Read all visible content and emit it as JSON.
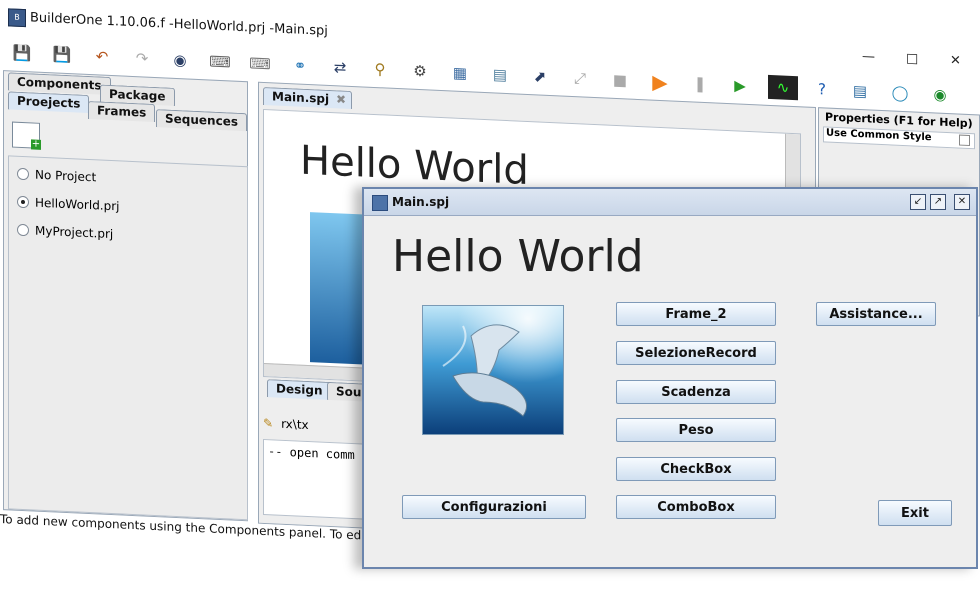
{
  "window": {
    "title": "BuilderOne 1.10.06.f -HelloWorld.prj -Main.spj",
    "app_icon": "app-icon"
  },
  "toolbar": {
    "icons": [
      "save-icon",
      "save-all-icon",
      "undo-icon",
      "redo-icon",
      "binoculars-icon",
      "keyboard-icon",
      "keyboard-small-icon",
      "network-icon",
      "connector-icon",
      "key-icon",
      "gear-icon",
      "table-icon",
      "book-icon",
      "export-icon",
      "expand-icon",
      "stop-icon",
      "play-icon",
      "pause-icon",
      "run-icon",
      "monitor-icon",
      "help-icon",
      "image-icon",
      "globe-icon",
      "eye-icon"
    ]
  },
  "left_panel": {
    "tabs_row1": [
      "Components",
      "Package"
    ],
    "tabs_row2": [
      "Proejects",
      "Frames",
      "Sequences"
    ],
    "projects": [
      {
        "label": "No Project",
        "selected": false
      },
      {
        "label": "HelloWorld.prj",
        "selected": true
      },
      {
        "label": "MyProject.prj",
        "selected": false
      }
    ]
  },
  "center_panel": {
    "file_tab": "Main.spj",
    "canvas_heading": "Hello World",
    "bottom_tabs": [
      "Design",
      "Sou"
    ],
    "console_label": "rx\\tx",
    "console_text": "-- open comm"
  },
  "right_panel": {
    "title": "Properties (F1 for Help)",
    "row1": "Use Common Style"
  },
  "status": {
    "text": "To add new components using the Components panel. To edit a"
  },
  "dialog": {
    "title": "Main.spj",
    "heading": "Hello World",
    "buttons": {
      "frame2": "Frame_2",
      "selezione": "SelezioneRecord",
      "scadenza": "Scadenza",
      "peso": "Peso",
      "checkbox": "CheckBox",
      "combobox": "ComboBox",
      "configurazioni": "Configurazioni",
      "assistance": "Assistance...",
      "exit": "Exit"
    }
  }
}
